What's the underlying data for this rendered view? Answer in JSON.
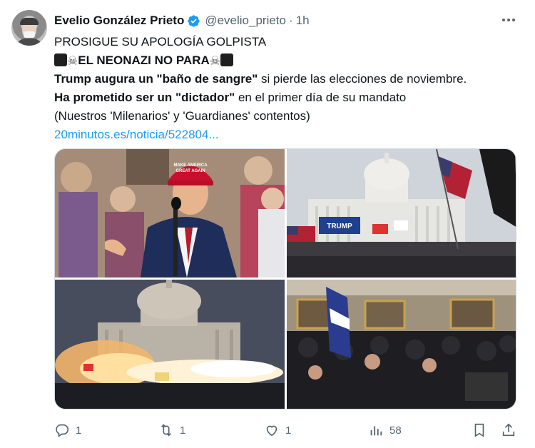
{
  "tweet": {
    "author_name": "Evelio González Prieto",
    "handle": "@evelio_prieto",
    "separator": "·",
    "time": "1h",
    "lines": {
      "l1": "PROSIGUE SU APOLOGÍA GOLPISTA",
      "l2": "EL NEONAZI NO PARA",
      "l3_bold": "Trump augura un \"baño de sangre\"",
      "l3_rest": " si pierde las elecciones de noviembre.",
      "l4_bold": "Ha prometido ser un \"dictador\"",
      "l4_rest": " en el primer día de su mandato",
      "l5": "(Nuestros 'Milenarios' y 'Guardianes' contentos)"
    },
    "link": "20minutos.es/noticia/522804...",
    "images": {
      "img1_cap": "MAKE AMERICA GREAT AGAIN",
      "img2_banner": "TRUMP"
    },
    "emoji": {
      "square": "black-square-icon",
      "skull": "skull-crossbones-icon"
    }
  },
  "actions": {
    "reply_count": "1",
    "retweet_count": "1",
    "like_count": "1",
    "views_count": "58"
  },
  "colors": {
    "accent": "#1d9bf0",
    "muted": "#536471",
    "text": "#0f1419"
  }
}
